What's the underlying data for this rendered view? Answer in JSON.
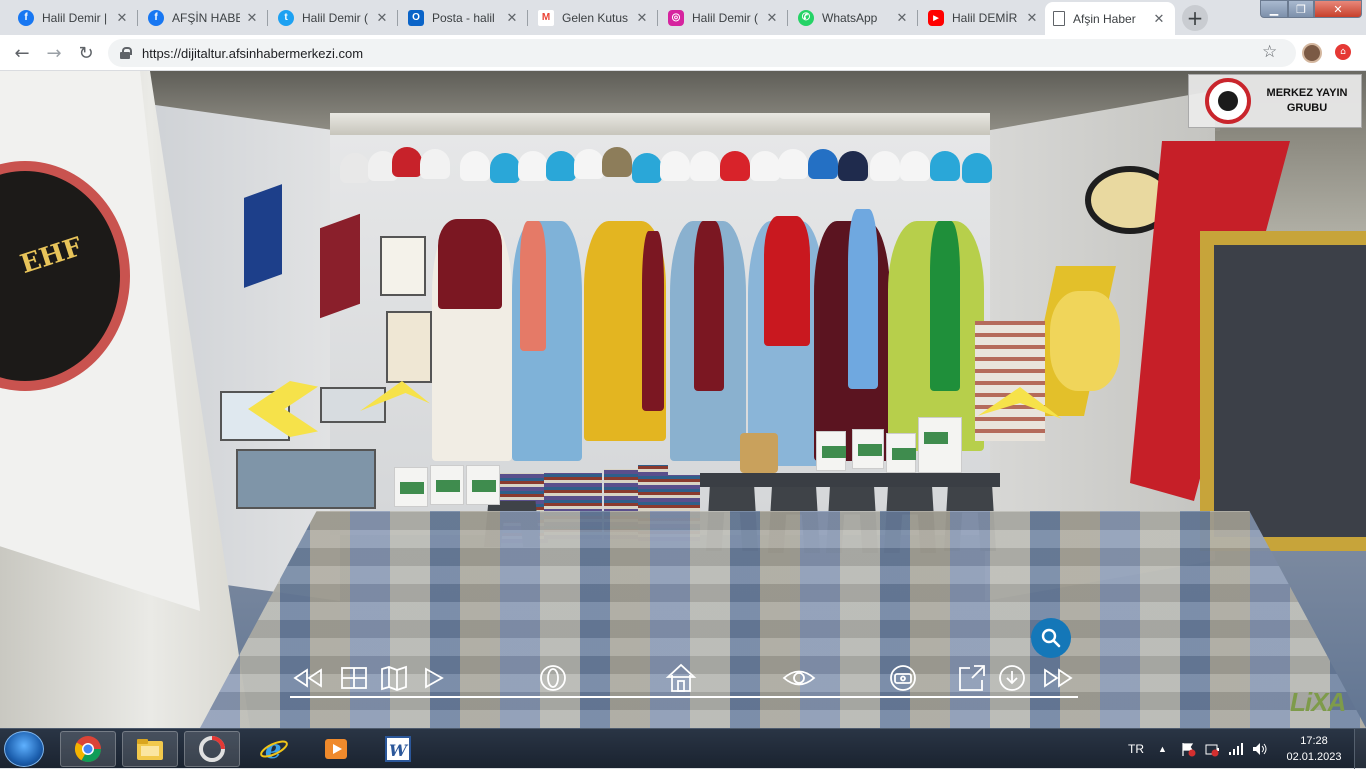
{
  "browser": {
    "tabs": [
      {
        "label": "Halil Demir |",
        "icon": "facebook-icon",
        "icon_color": "#1877f2",
        "glyph": "f"
      },
      {
        "label": "AFŞİN HABE",
        "icon": "facebook-icon",
        "icon_color": "#1877f2",
        "glyph": "f"
      },
      {
        "label": "Halil Demir (",
        "icon": "twitter-icon",
        "icon_color": "#1da1f2",
        "glyph": "t"
      },
      {
        "label": "Posta - halil",
        "icon": "outlook-icon",
        "icon_color": "#0a64c8",
        "glyph": "O"
      },
      {
        "label": "Gelen Kutus",
        "icon": "gmail-icon",
        "icon_color": "#ea4335",
        "glyph": "M"
      },
      {
        "label": "Halil Demir (",
        "icon": "instagram-icon",
        "icon_color": "#d6249f",
        "glyph": "◎"
      },
      {
        "label": "WhatsApp",
        "icon": "whatsapp-icon",
        "icon_color": "#25d366",
        "glyph": "✆"
      },
      {
        "label": "Halil DEMİR",
        "icon": "youtube-icon",
        "icon_color": "#ff0000",
        "glyph": "▶"
      },
      {
        "label": "Afşin Haber",
        "icon": "page-icon",
        "icon_color": "#ffffff",
        "glyph": ""
      }
    ],
    "url": "https://dijitaltur.afsinhabermerkezi.com"
  },
  "tour": {
    "logo_text": "MERKEZ YAYIN GRUBU",
    "brand": "LiXA",
    "controls": [
      {
        "name": "rewind-icon"
      },
      {
        "name": "thumbnails-grid-icon"
      },
      {
        "name": "map-icon"
      },
      {
        "name": "play-icon"
      },
      {
        "name": "gyroscope-icon"
      },
      {
        "name": "home-icon"
      },
      {
        "name": "view-mode-eye-icon"
      },
      {
        "name": "vr-goggles-icon"
      },
      {
        "name": "fullscreen-icon"
      },
      {
        "name": "download-icon"
      },
      {
        "name": "fast-forward-icon"
      }
    ],
    "accent": "#1477b8"
  },
  "taskbar": {
    "language": "TR",
    "time": "17:28",
    "date": "02.01.2023",
    "apps": [
      "chrome-icon",
      "explorer-folder-icon",
      "media-app-icon",
      "internet-explorer-icon",
      "video-player-icon",
      "word-icon"
    ]
  }
}
